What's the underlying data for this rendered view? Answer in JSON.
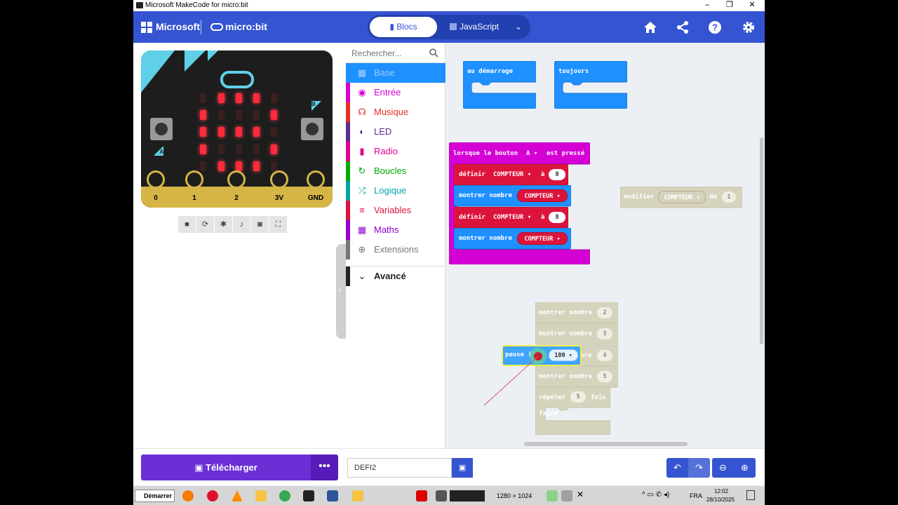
{
  "window": {
    "title": "Microsoft MakeCode for micro:bit",
    "controls": [
      "–",
      "❐",
      "✕"
    ]
  },
  "header": {
    "brand": "Microsoft",
    "product": "micro:bit",
    "tabs": [
      {
        "label": "Blocs"
      },
      {
        "label": "JavaScript"
      }
    ],
    "icons": [
      "home-icon",
      "share-icon",
      "help-icon",
      "settings-icon"
    ]
  },
  "simulator": {
    "pins": [
      "0",
      "1",
      "2",
      "3V",
      "GND"
    ],
    "button_a": "A",
    "button_b": "B",
    "toolbar": [
      "stop-icon",
      "restart-icon",
      "debug-icon",
      "mute-icon",
      "screenshot-icon",
      "fullscreen-icon"
    ],
    "led_matrix": [
      [
        0,
        1,
        1,
        1,
        0
      ],
      [
        1,
        0,
        0,
        0,
        1
      ],
      [
        1,
        1,
        1,
        1,
        0
      ],
      [
        1,
        0,
        0,
        0,
        1
      ],
      [
        0,
        1,
        1,
        1,
        0
      ]
    ]
  },
  "toolbox": {
    "search_placeholder": "Rechercher...",
    "categories": [
      {
        "label": "Base",
        "color": "#1e90ff",
        "icon": "grid-icon"
      },
      {
        "label": "Entrée",
        "color": "#d400d4",
        "icon": "circle-icon"
      },
      {
        "label": "Musique",
        "color": "#e63022",
        "icon": "headphones-icon"
      },
      {
        "label": "LED",
        "color": "#5c2d91",
        "icon": "toggle-icon"
      },
      {
        "label": "Radio",
        "color": "#e3008c",
        "icon": "signal-icon"
      },
      {
        "label": "Boucles",
        "color": "#00aa00",
        "icon": "refresh-icon"
      },
      {
        "label": "Logique",
        "color": "#00a4a6",
        "icon": "shuffle-icon"
      },
      {
        "label": "Variables",
        "color": "#dc143c",
        "icon": "list-icon"
      },
      {
        "label": "Maths",
        "color": "#9400d3",
        "icon": "calculator-icon"
      },
      {
        "label": "Extensions",
        "color": "#777777",
        "icon": "plus-circle-icon"
      },
      {
        "label": "Avancé",
        "color": "#222222",
        "icon": "chevron-down-icon"
      }
    ]
  },
  "workspace": {
    "on_start": "au démarrage",
    "forever": "toujours",
    "event": {
      "prefix": "lorsque le bouton",
      "button": "A ▾",
      "suffix": "est pressé"
    },
    "set1": {
      "label": "définir",
      "var": "COMPTEUR ▾",
      "to": "à",
      "value": "0"
    },
    "show1": {
      "label": "montrer nombre",
      "var": "COMPTEUR ▾"
    },
    "set2": {
      "label": "définir",
      "var": "COMPTEUR ▾",
      "to": "à",
      "value": "8"
    },
    "show2": {
      "label": "montrer nombre",
      "var": "COMPTEUR ▾"
    },
    "change": {
      "label": "modifier",
      "var": "COMPTEUR ▾",
      "by": "de",
      "value": "1"
    },
    "ghost": [
      {
        "label": "montrer nombre",
        "value": "2"
      },
      {
        "label": "montrer nombre",
        "value": "3"
      },
      {
        "label": "bre",
        "value": "4"
      },
      {
        "label": "montrer nombre",
        "value": "5"
      }
    ],
    "repeat": {
      "label": "répéter",
      "value": "5",
      "times": "fois",
      "do": "faire"
    },
    "pause": {
      "label": "pause (",
      "value": "100 ▾"
    }
  },
  "footer": {
    "download": "Télécharger",
    "more": "•••",
    "project_name": "DEFI2"
  },
  "taskbar": {
    "start": "Démarrer",
    "resolution": "1280 × 1024",
    "lang": "FRA",
    "time": "12:02",
    "date": "28/10/2025"
  }
}
